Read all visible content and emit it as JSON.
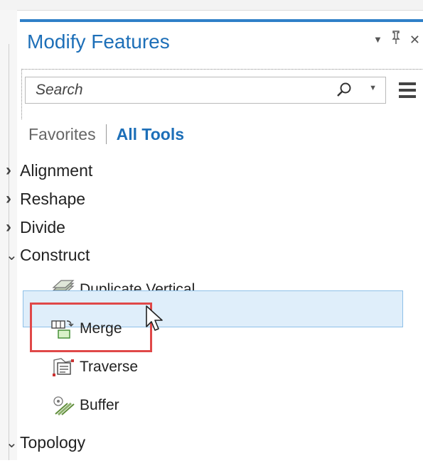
{
  "pane": {
    "title": "Modify Features",
    "controls": {
      "dropdown": "▾",
      "pin": "📌",
      "close": "✕"
    }
  },
  "search": {
    "placeholder": "Search",
    "value": ""
  },
  "tabs": {
    "favorites": "Favorites",
    "all_tools": "All Tools"
  },
  "groups": [
    {
      "label": "Alignment",
      "state": "collapsed"
    },
    {
      "label": "Reshape",
      "state": "collapsed"
    },
    {
      "label": "Divide",
      "state": "collapsed"
    },
    {
      "label": "Construct",
      "state": "expanded"
    },
    {
      "label": "Topology",
      "state": "expanded"
    }
  ],
  "construct_tools": [
    {
      "label": "Duplicate Vertical",
      "icon": "duplicate-vertical-icon"
    },
    {
      "label": "Merge",
      "icon": "merge-icon",
      "selected": true
    },
    {
      "label": "Traverse",
      "icon": "traverse-icon"
    },
    {
      "label": "Buffer",
      "icon": "buffer-icon"
    }
  ],
  "colors": {
    "accent": "#2f80c8",
    "title": "#1d6fb8",
    "selection": "#dfeefa",
    "highlight": "#e04848"
  }
}
